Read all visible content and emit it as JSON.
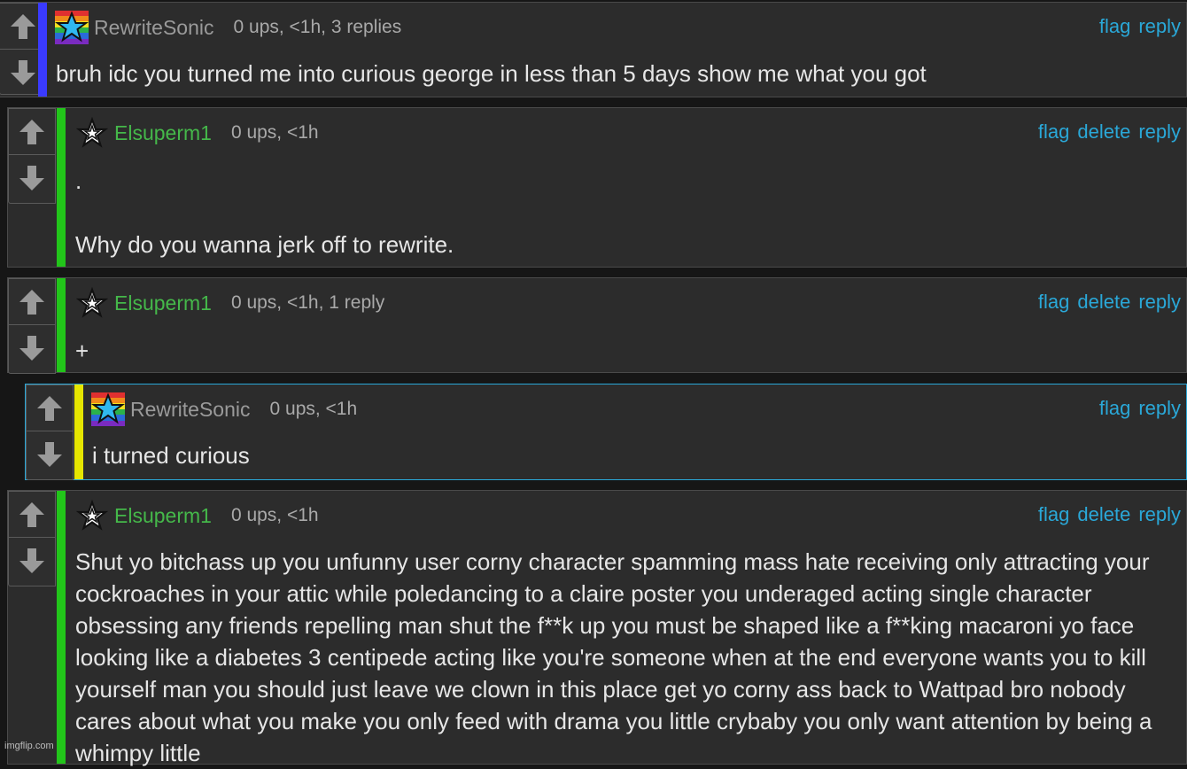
{
  "colors": {
    "bar_blue": "#3a3aff",
    "bar_green": "#22c51a",
    "bar_yellow": "#e6e600",
    "link": "#2aa8d8",
    "username_green": "#45b84a",
    "username_grey": "#9a9a9a"
  },
  "comments": [
    {
      "user": "RewriteSonic",
      "avatar": "rainbow-star-avatar",
      "meta": "0 ups, <1h, 3 replies",
      "actions": [
        "flag",
        "reply"
      ],
      "body": "bruh idc you turned me into curious george in less than 5 days show me what you got"
    },
    {
      "user": "Elsuperm1",
      "avatar": "star-outline-avatar",
      "meta": "0 ups, <1h",
      "actions": [
        "flag",
        "delete",
        "reply"
      ],
      "body": ".\n\nWhy do you wanna jerk off to rewrite."
    },
    {
      "user": "Elsuperm1",
      "avatar": "star-outline-avatar",
      "meta": "0 ups, <1h, 1 reply",
      "actions": [
        "flag",
        "delete",
        "reply"
      ],
      "body": "+"
    },
    {
      "user": "RewriteSonic",
      "avatar": "rainbow-star-avatar",
      "meta": "0 ups, <1h",
      "actions": [
        "flag",
        "reply"
      ],
      "body": "i turned curious"
    },
    {
      "user": "Elsuperm1",
      "avatar": "star-outline-avatar",
      "meta": "0 ups, <1h",
      "actions": [
        "flag",
        "delete",
        "reply"
      ],
      "body": "Shut yo bitchass up you unfunny user corny character spamming mass hate receiving only attracting your cockroaches in your attic while poledancing to a claire poster you underaged acting single character obsessing any friends repelling man shut the f**k up you must be shaped like a f**king macaroni yo face looking like a diabetes 3 centipede acting like you're someone when at the end everyone wants you to kill yourself man you should just leave we clown in this place get yo corny ass back to Wattpad bro nobody cares about what you make you only feed with drama you little crybaby you only want attention by being a whimpy little"
    }
  ],
  "watermark": "imgflip.com"
}
